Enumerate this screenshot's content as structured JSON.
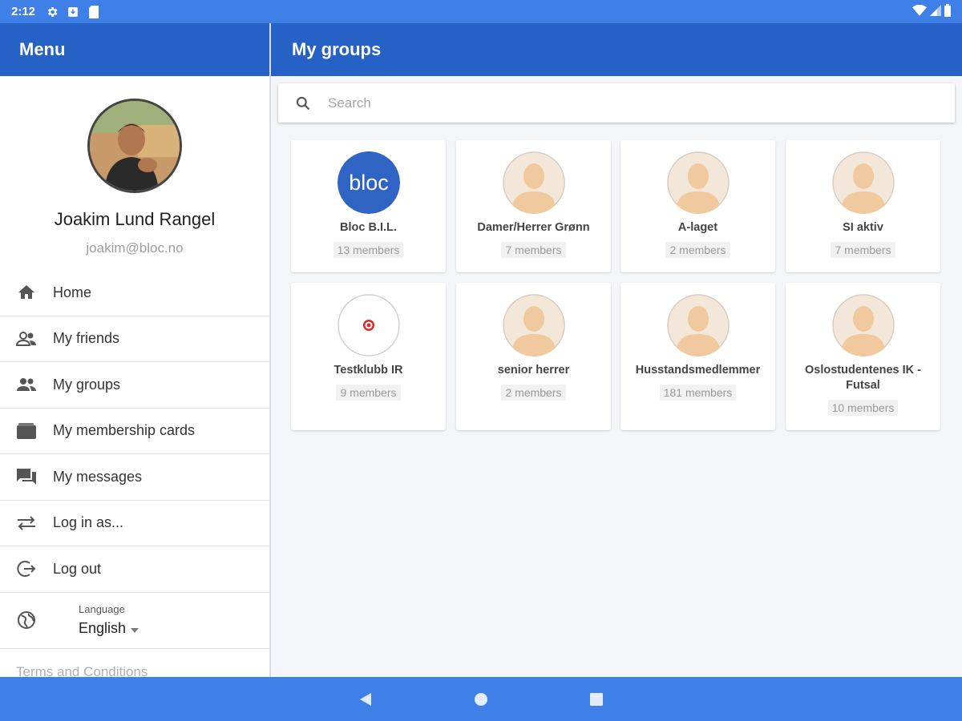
{
  "status_bar": {
    "time": "2:12"
  },
  "drawer": {
    "title": "Menu",
    "profile": {
      "name": "Joakim Lund Rangel",
      "email": "joakim@bloc.no"
    },
    "items": [
      {
        "label": "Home",
        "icon": "home-icon"
      },
      {
        "label": "My friends",
        "icon": "friends-icon"
      },
      {
        "label": "My groups",
        "icon": "groups-icon"
      },
      {
        "label": "My membership cards",
        "icon": "wallet-icon"
      },
      {
        "label": "My messages",
        "icon": "messages-icon"
      },
      {
        "label": "Log in as...",
        "icon": "swap-icon"
      },
      {
        "label": "Log out",
        "icon": "logout-icon"
      }
    ],
    "language": {
      "caption": "Language",
      "selected": "English",
      "icon": "globe-icon"
    },
    "terms": "Terms and Conditions"
  },
  "main": {
    "title": "My groups",
    "search": {
      "placeholder": "Search",
      "value": ""
    },
    "groups": [
      {
        "name": "Bloc B.I.L.",
        "members": "13 members",
        "avatar": "bloc-logo",
        "logo_text": "bloc"
      },
      {
        "name": "Damer/Herrer Grønn",
        "members": "7 members",
        "avatar": "default-person"
      },
      {
        "name": "A-laget",
        "members": "2 members",
        "avatar": "default-person"
      },
      {
        "name": "SI aktiv",
        "members": "7 members",
        "avatar": "default-person"
      },
      {
        "name": "Testklubb IR",
        "members": "9 members",
        "avatar": "target-logo"
      },
      {
        "name": "senior herrer",
        "members": "2 members",
        "avatar": "default-person"
      },
      {
        "name": "Husstandsmedlemmer",
        "members": "181 members",
        "avatar": "default-person"
      },
      {
        "name": "Oslostudentenes IK - Futsal",
        "members": "10 members",
        "avatar": "default-person"
      }
    ]
  },
  "colors": {
    "status_bar": "#3e7fe8",
    "header": "#2662c5",
    "bloc_blue": "#2f64c4",
    "background": "#f3f5f9"
  }
}
